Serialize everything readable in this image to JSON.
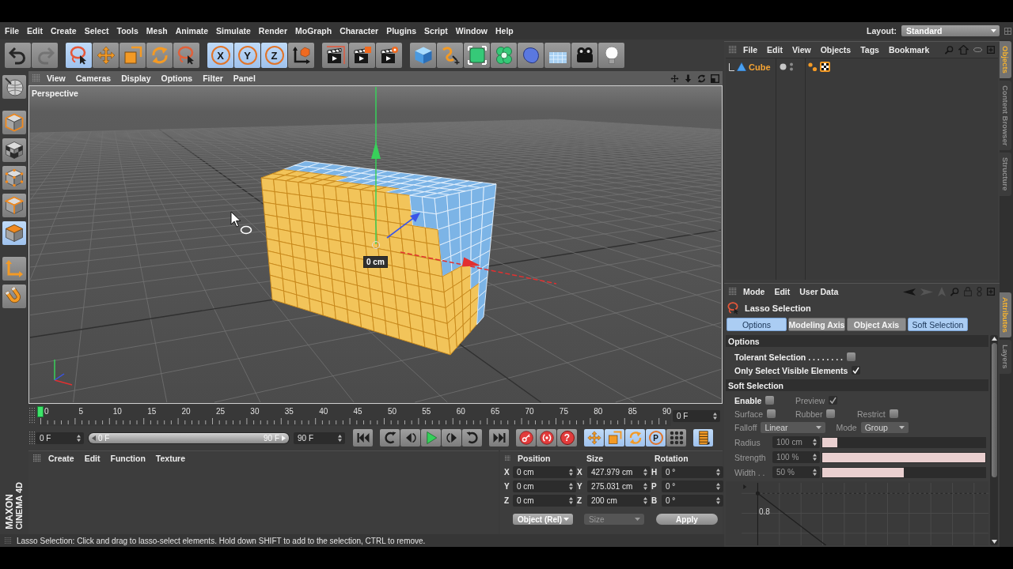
{
  "menu_bar": {
    "items": [
      "File",
      "Edit",
      "Create",
      "Select",
      "Tools",
      "Mesh",
      "Animate",
      "Simulate",
      "Render",
      "MoGraph",
      "Character",
      "Plugins",
      "Script",
      "Window",
      "Help"
    ],
    "layout_label": "Layout:",
    "layout_value": "Standard"
  },
  "toolbar": [
    {
      "items": [
        {
          "kind": "undo",
          "selected": false,
          "disabled": false
        },
        {
          "kind": "redo",
          "selected": false,
          "disabled": true
        }
      ]
    },
    {
      "items": [
        {
          "kind": "lasso",
          "selected": true,
          "disabled": false
        },
        {
          "kind": "move",
          "selected": false,
          "disabled": false
        },
        {
          "kind": "scale",
          "selected": false,
          "disabled": false
        },
        {
          "kind": "rotate",
          "selected": false,
          "disabled": false
        },
        {
          "kind": "last-tool",
          "selected": false,
          "disabled": false
        }
      ]
    },
    {
      "items": [
        {
          "kind": "axis",
          "label": "X",
          "selected": true,
          "disabled": false
        },
        {
          "kind": "axis",
          "label": "Y",
          "selected": true,
          "disabled": false
        },
        {
          "kind": "axis",
          "label": "Z",
          "selected": true,
          "disabled": false
        },
        {
          "kind": "world",
          "selected": false,
          "disabled": false
        }
      ]
    },
    {
      "items": [
        {
          "kind": "render-view",
          "selected": false,
          "disabled": false
        },
        {
          "kind": "render-picture",
          "selected": false,
          "disabled": false
        },
        {
          "kind": "render-settings",
          "selected": false,
          "disabled": false
        }
      ]
    },
    {
      "items": [
        {
          "kind": "cube",
          "selected": false,
          "disabled": false
        },
        {
          "kind": "spline",
          "selected": false,
          "disabled": false
        },
        {
          "kind": "subdivision",
          "selected": false,
          "disabled": false
        },
        {
          "kind": "cloner",
          "selected": false,
          "disabled": false
        },
        {
          "kind": "deformer",
          "selected": false,
          "disabled": false
        },
        {
          "kind": "floor",
          "selected": false,
          "disabled": false
        },
        {
          "kind": "camera",
          "selected": false,
          "disabled": false
        },
        {
          "kind": "light",
          "selected": false,
          "disabled": false
        }
      ]
    }
  ],
  "palette": [
    {
      "items": [
        {
          "kind": "make-editable",
          "selected": false
        }
      ]
    },
    {
      "items": [
        {
          "kind": "model",
          "selected": false
        },
        {
          "kind": "texture",
          "selected": false
        },
        {
          "kind": "points",
          "selected": false
        },
        {
          "kind": "edges",
          "selected": false
        },
        {
          "kind": "polygons",
          "selected": true
        }
      ]
    },
    {
      "items": [
        {
          "kind": "axis-mode",
          "selected": false
        },
        {
          "kind": "snap",
          "selected": false
        }
      ]
    }
  ],
  "logo": {
    "brand": "MAXON",
    "product": "CINEMA 4D"
  },
  "viewport": {
    "menu": [
      "View",
      "Cameras",
      "Display",
      "Options",
      "Filter",
      "Panel"
    ],
    "camera_label": "Perspective",
    "measure_label": "0 cm"
  },
  "timeline": {
    "labels": [
      "0",
      "5",
      "10",
      "15",
      "20",
      "25",
      "30",
      "35",
      "40",
      "45",
      "50",
      "55",
      "60",
      "65",
      "70",
      "75",
      "80",
      "85",
      "90"
    ],
    "playhead": {
      "level": 0
    },
    "current_frame": "0 F"
  },
  "transport": {
    "start_field": "0 F",
    "range": {
      "start": "0 F",
      "end": "90 F",
      "level": 1
    },
    "end_field": "90 F",
    "groups": [
      {
        "items": [
          {
            "kind": "go-start",
            "selected": false
          }
        ]
      },
      {
        "items": [
          {
            "kind": "prev-key",
            "selected": false
          },
          {
            "kind": "prev-frame",
            "selected": false
          },
          {
            "kind": "play",
            "selected": false
          },
          {
            "kind": "next-frame",
            "selected": false
          },
          {
            "kind": "next-key",
            "selected": false
          }
        ]
      },
      {
        "items": [
          {
            "kind": "go-end",
            "selected": false
          }
        ]
      },
      {
        "items": [
          {
            "kind": "record",
            "selected": false
          },
          {
            "kind": "autokey",
            "selected": false
          },
          {
            "kind": "key-help",
            "label": "?",
            "selected": false
          }
        ]
      },
      {
        "items": [
          {
            "kind": "move-key",
            "selected": true
          },
          {
            "kind": "scale-key",
            "selected": true
          },
          {
            "kind": "rotate-key",
            "selected": true
          },
          {
            "kind": "param-key",
            "label": "P",
            "selected": true
          },
          {
            "kind": "point-key",
            "selected": false
          }
        ]
      },
      {
        "items": [
          {
            "kind": "timeline",
            "selected": true
          }
        ]
      }
    ]
  },
  "material_manager": {
    "menu": [
      "Create",
      "Edit",
      "Function",
      "Texture"
    ]
  },
  "coordinates": {
    "headers": [
      "Position",
      "Size",
      "Rotation"
    ],
    "rows": [
      [
        {
          "axis": "X",
          "value": "0 cm"
        },
        {
          "axis": "X",
          "value": "427.979 cm"
        },
        {
          "axis": "H",
          "value": "0 °"
        }
      ],
      [
        {
          "axis": "Y",
          "value": "0 cm"
        },
        {
          "axis": "Y",
          "value": "275.031 cm"
        },
        {
          "axis": "P",
          "value": "0 °"
        }
      ],
      [
        {
          "axis": "Z",
          "value": "0 cm"
        },
        {
          "axis": "Z",
          "value": "200 cm"
        },
        {
          "axis": "B",
          "value": "0 °"
        }
      ]
    ],
    "mode_dropdown": "Object (Rel)",
    "size_dropdown": "Size",
    "apply_button": "Apply"
  },
  "status_bar": "Lasso Selection: Click and drag to lasso-select elements. Hold down SHIFT to add to the selection, CTRL to remove.",
  "object_manager": {
    "menu": [
      "File",
      "Edit",
      "View",
      "Objects",
      "Tags",
      "Bookmark"
    ],
    "objects": [
      {
        "name": "Cube",
        "selected": true
      }
    ]
  },
  "attribute_manager": {
    "menu": [
      "Mode",
      "Edit",
      "User Data"
    ],
    "title": "Lasso Selection",
    "tabs": [
      {
        "label": "Options",
        "selected": true
      },
      {
        "label": "Modeling Axis",
        "selected": false
      },
      {
        "label": "Object Axis",
        "selected": false
      },
      {
        "label": "Soft Selection",
        "selected": true
      }
    ],
    "options": {
      "title": "Options",
      "checks": [
        {
          "label": "Tolerant Selection . . . . . . . .",
          "checked": false
        },
        {
          "label": "Only Select Visible Elements",
          "checked": true
        }
      ]
    },
    "soft_selection": {
      "title": "Soft Selection",
      "check_rows": [
        [
          {
            "label": "Enable",
            "checked": false,
            "disabled": false
          },
          {
            "label": "Preview",
            "checked": true,
            "disabled": true
          }
        ],
        [
          {
            "label": "Surface",
            "checked": false,
            "disabled": true
          },
          {
            "label": "Rubber",
            "checked": false,
            "disabled": true
          },
          {
            "label": "Restrict",
            "checked": false,
            "disabled": true
          }
        ]
      ],
      "dropdowns": [
        {
          "label": "Falloff",
          "value": "Linear",
          "disabled": true
        },
        {
          "label": "Mode",
          "value": "Group",
          "disabled": true
        }
      ],
      "sliders": [
        {
          "label": "Radius",
          "value": "100 cm",
          "level": 0.09,
          "disabled": true
        },
        {
          "label": "Strength",
          "value": "100 %",
          "level": 1,
          "disabled": true
        },
        {
          "label": "Width . .",
          "value": "50 %",
          "level": 0.5,
          "disabled": true
        }
      ],
      "graph_label": "0.8"
    }
  },
  "side_tabs": {
    "top": [
      {
        "label": "Objects",
        "selected": true
      },
      {
        "label": "Content Browser",
        "selected": false
      },
      {
        "label": "Structure",
        "selected": false
      }
    ],
    "bottom": [
      {
        "label": "Attributes",
        "selected": true
      },
      {
        "label": "Layers",
        "selected": false
      }
    ]
  }
}
